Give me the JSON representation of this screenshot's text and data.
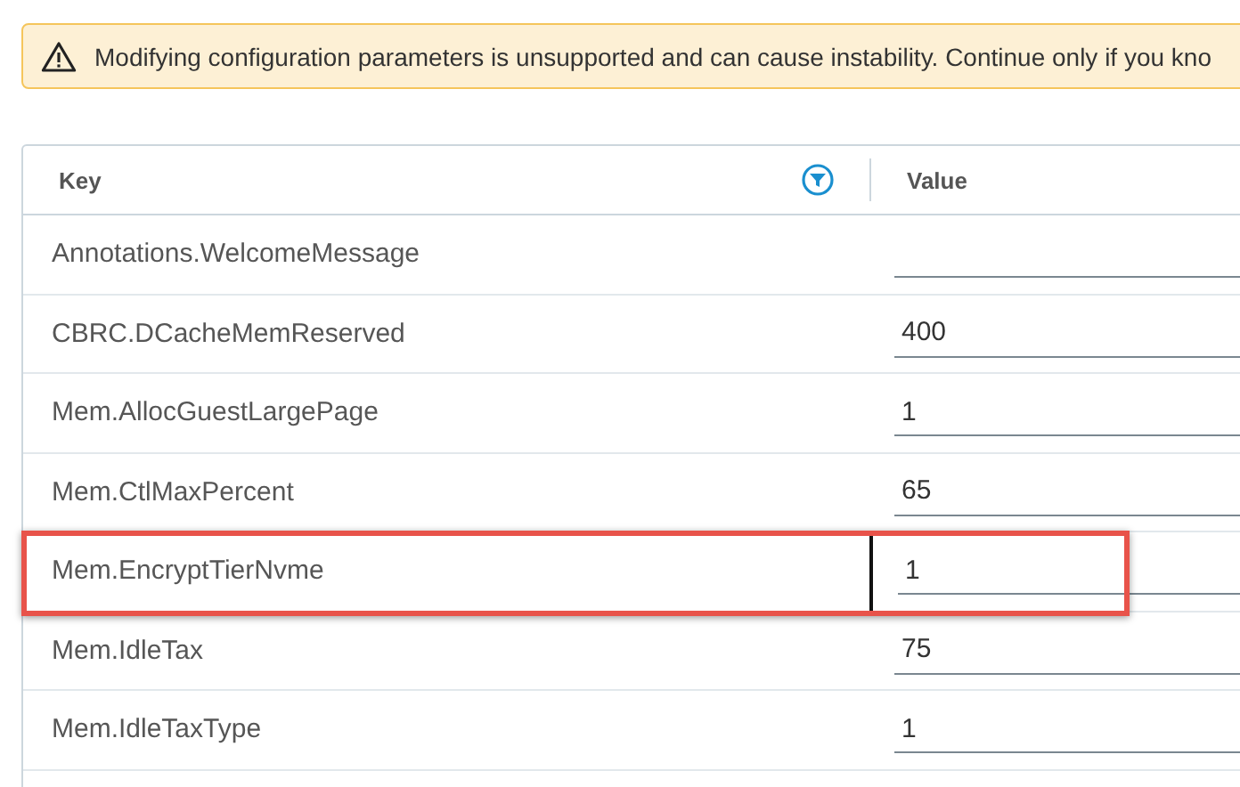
{
  "warning": {
    "text": "Modifying configuration parameters is unsupported and can cause instability. Continue only if you kno"
  },
  "table": {
    "columns": [
      {
        "label": "Key",
        "filter": true
      },
      {
        "label": "Value",
        "filter": false
      }
    ],
    "rows": [
      {
        "key": "Annotations.WelcomeMessage",
        "value": "",
        "highlighted": false
      },
      {
        "key": "CBRC.DCacheMemReserved",
        "value": "400",
        "highlighted": false
      },
      {
        "key": "Mem.AllocGuestLargePage",
        "value": "1",
        "highlighted": false
      },
      {
        "key": "Mem.CtlMaxPercent",
        "value": "65",
        "highlighted": false
      },
      {
        "key": "Mem.EncryptTierNvme",
        "value": "1",
        "highlighted": true
      },
      {
        "key": "Mem.IdleTax",
        "value": "75",
        "highlighted": false
      },
      {
        "key": "Mem.IdleTaxType",
        "value": "1",
        "highlighted": false
      }
    ]
  }
}
